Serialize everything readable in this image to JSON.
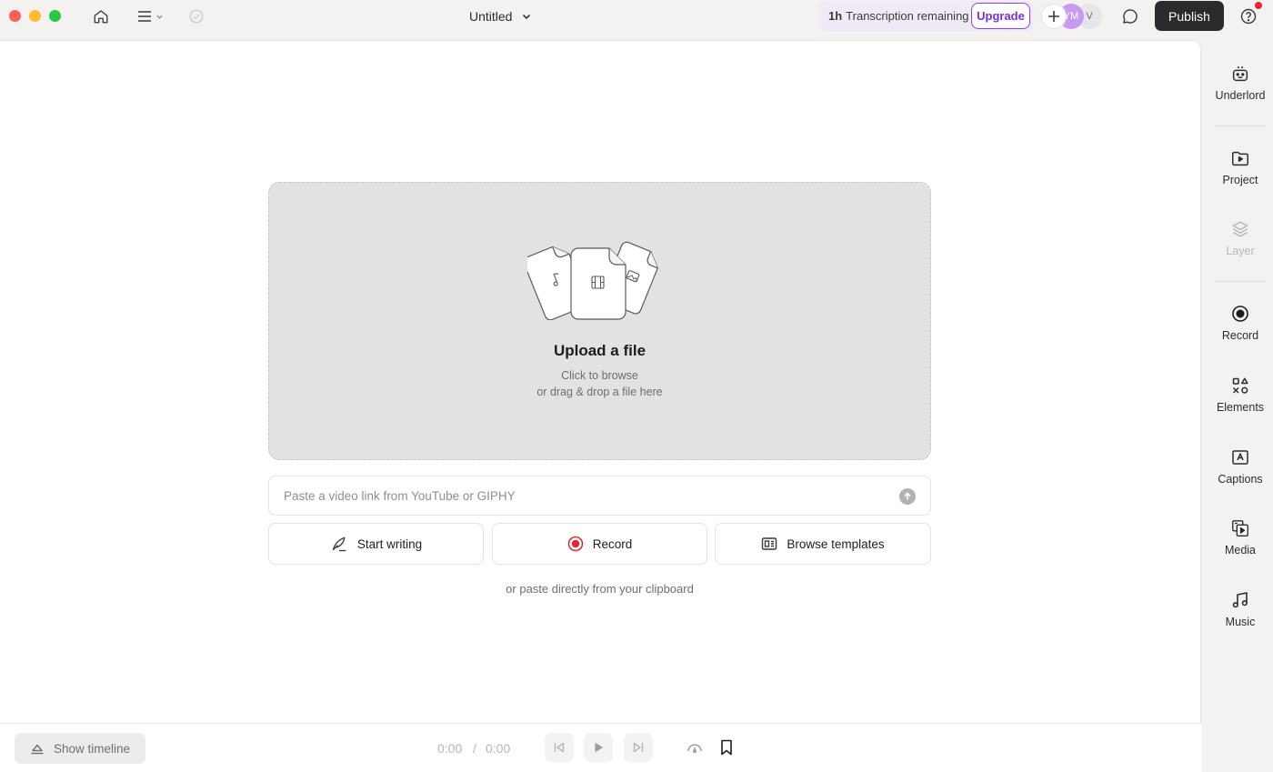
{
  "window": {
    "title": "Untitled"
  },
  "topbar": {
    "transcription_amount": "1h",
    "transcription_text": "Transcription remaining",
    "upgrade_label": "Upgrade",
    "avatars": [
      {
        "initials": "YM",
        "color": "#c79cf0"
      },
      {
        "initials": "V",
        "color": "#e6e6e8"
      }
    ],
    "publish_label": "Publish"
  },
  "upload": {
    "title": "Upload a file",
    "line1": "Click to browse",
    "line2": "or drag & drop a file here"
  },
  "link_input": {
    "placeholder": "Paste a video link from YouTube or GIPHY",
    "value": ""
  },
  "actions": {
    "start_writing": "Start writing",
    "record": "Record",
    "browse_templates": "Browse templates"
  },
  "clipboard_note": "or paste directly from your clipboard",
  "bottombar": {
    "show_timeline": "Show timeline",
    "current_time": "0:00",
    "separator": "/",
    "total_time": "0:00"
  },
  "sidebar": {
    "items": [
      {
        "label": "Underlord",
        "icon": "robot-icon",
        "enabled": true
      },
      {
        "label": "Project",
        "icon": "project-folder-icon",
        "enabled": true
      },
      {
        "label": "Layer",
        "icon": "layers-icon",
        "enabled": false
      },
      {
        "label": "Record",
        "icon": "record-icon",
        "enabled": true
      },
      {
        "label": "Elements",
        "icon": "elements-icon",
        "enabled": true
      },
      {
        "label": "Captions",
        "icon": "captions-icon",
        "enabled": true
      },
      {
        "label": "Media",
        "icon": "media-icon",
        "enabled": true
      },
      {
        "label": "Music",
        "icon": "music-icon",
        "enabled": true
      }
    ]
  },
  "colors": {
    "accent_purple": "#8a3ffc",
    "publish_bg": "#2b2b2d",
    "record_red": "#e5262e",
    "dropzone_bg": "#e2e2e2"
  }
}
